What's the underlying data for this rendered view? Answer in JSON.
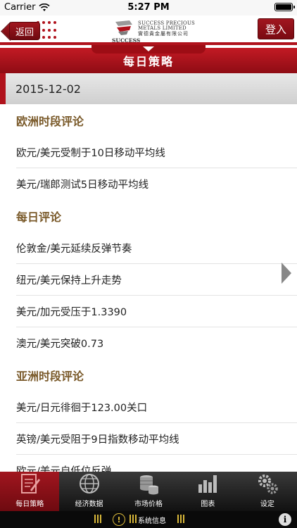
{
  "status_bar": {
    "carrier": "Carrier",
    "time": "5:27 PM"
  },
  "header": {
    "back_label": "返回",
    "logo_en_line1": "SUCCESS PRECIOUS",
    "logo_en_line2": "METALS LIMITED",
    "logo_cn": "實德貴金屬有限公司",
    "logo_brand": "SUCCESS",
    "login_label": "登入",
    "brand_color": "#b0121c"
  },
  "title_bar": {
    "title": "每日策略"
  },
  "date_bar": {
    "date": "2015-12-02"
  },
  "sections": [
    {
      "title": "欧洲时段评论",
      "items": [
        "欧元/美元受制于10日移动平均线",
        "美元/瑞郎测试5日移动平均线"
      ]
    },
    {
      "title": "每日评论",
      "items": [
        "伦敦金/美元延续反弹节奏",
        "纽元/美元保持上升走势",
        "美元/加元受压于1.3390",
        "澳元/美元突破0.73"
      ]
    },
    {
      "title": "亚洲时段评论",
      "items": [
        "美元/日元徘徊于123.00关口",
        "英镑/美元受阻于9日指数移动平均线",
        "欧元/美元自低位反弹"
      ]
    }
  ],
  "tabs": [
    {
      "label": "每日策略",
      "icon": "notepad-icon",
      "active": true
    },
    {
      "label": "经济数据",
      "icon": "globe-icon",
      "active": false
    },
    {
      "label": "市场价格",
      "icon": "coins-icon",
      "active": false
    },
    {
      "label": "图表",
      "icon": "bar-chart-icon",
      "active": false
    },
    {
      "label": "设定",
      "icon": "gears-icon",
      "active": false
    }
  ],
  "system_bar": {
    "label": "系统信息",
    "info_glyph": "i",
    "badge_glyph": "!"
  }
}
